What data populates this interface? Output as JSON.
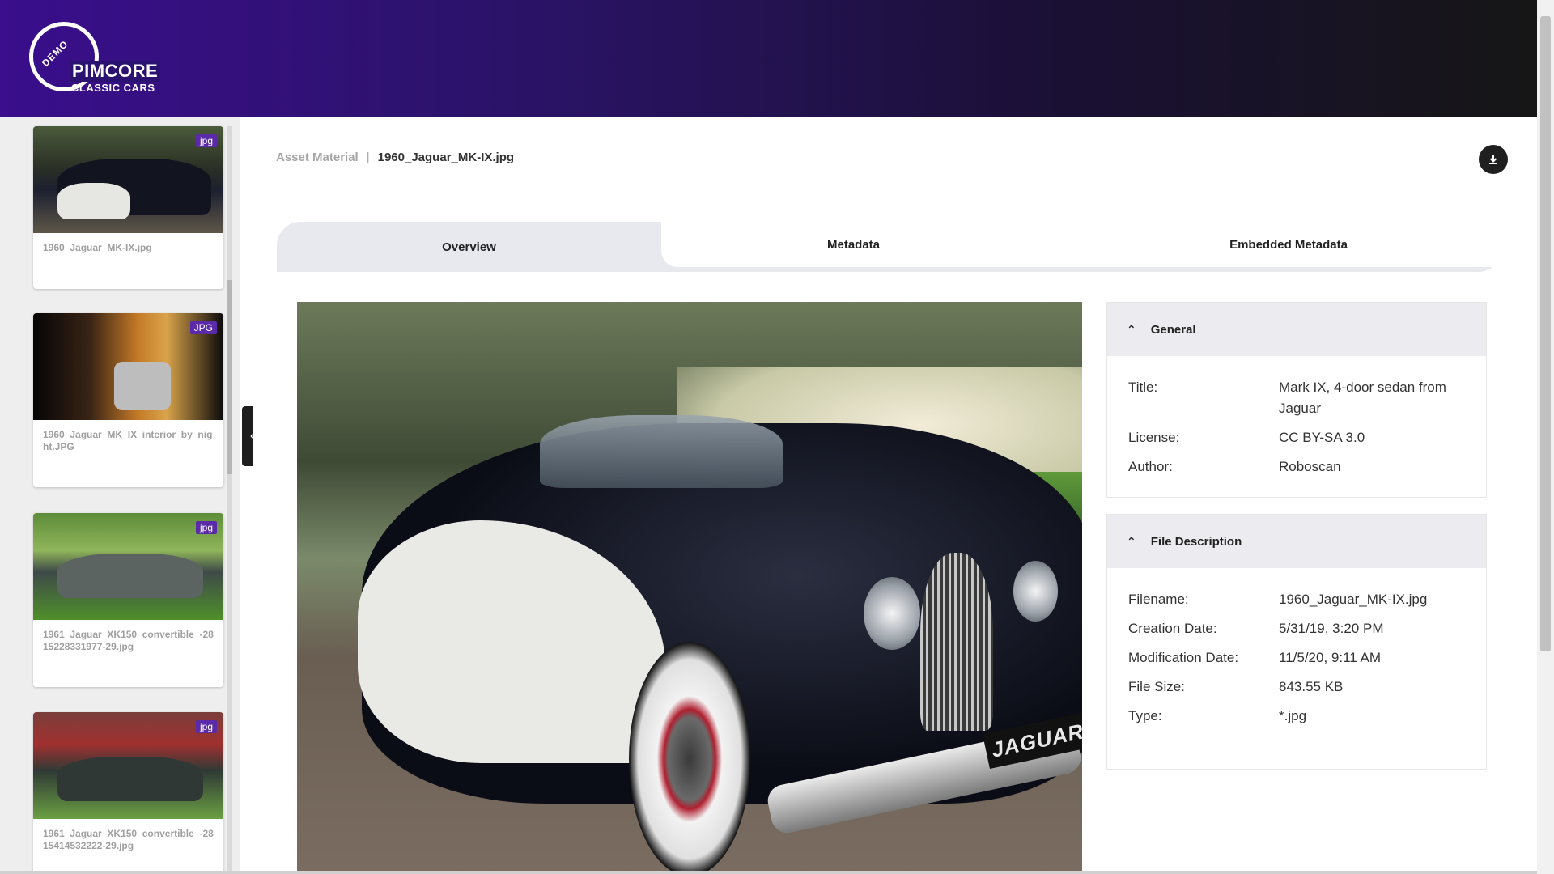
{
  "header": {
    "logo": {
      "demo_label": "DEMO",
      "brand": "PIMCORE",
      "subtitle": "CLASSIC CARS"
    }
  },
  "sidebar": {
    "items": [
      {
        "label": "1960_Jaguar_MK-IX.jpg",
        "badge": "jpg"
      },
      {
        "label": "1960_Jaguar_MK_IX_interior_by_night.JPG",
        "badge": "JPG"
      },
      {
        "label": "1961_Jaguar_XK150_convertible_-2815228331977-29.jpg",
        "badge": "jpg"
      },
      {
        "label": "1961_Jaguar_XK150_convertible_-2815414532222-29.jpg",
        "badge": "jpg"
      }
    ]
  },
  "breadcrumb": {
    "parent": "Asset Material",
    "separator": "|",
    "current": "1960_Jaguar_MK-IX.jpg"
  },
  "tabs": [
    {
      "label": "Overview",
      "active": true
    },
    {
      "label": "Metadata",
      "active": false
    },
    {
      "label": "Embedded Metadata",
      "active": false
    }
  ],
  "preview": {
    "plate_text": "JAGUAR"
  },
  "general": {
    "title": "General",
    "rows": [
      {
        "key": "Title:",
        "value": "Mark IX, 4-door sedan from Jaguar"
      },
      {
        "key": "License:",
        "value": "CC BY-SA 3.0"
      },
      {
        "key": "Author:",
        "value": "Roboscan"
      }
    ]
  },
  "file_description": {
    "title": "File Description",
    "rows": [
      {
        "key": "Filename:",
        "value": "1960_Jaguar_MK-IX.jpg"
      },
      {
        "key": "Creation Date:",
        "value": "5/31/19, 3:20 PM"
      },
      {
        "key": "Modification Date:",
        "value": "11/5/20, 9:11 AM"
      },
      {
        "key": "File Size:",
        "value": "843.55 KB"
      },
      {
        "key": "Type:",
        "value": "*.jpg"
      }
    ]
  },
  "colors": {
    "header_gradient_start": "#3a0e8c",
    "header_gradient_end": "#161616",
    "badge": "#5a2aa8",
    "tab_bar": "#e8e8ef",
    "panel_header": "#ebebf0"
  },
  "icons": {
    "download": "download-icon",
    "collapse": "chevron-left-icon",
    "panel_toggle": "chevron-up-icon"
  }
}
